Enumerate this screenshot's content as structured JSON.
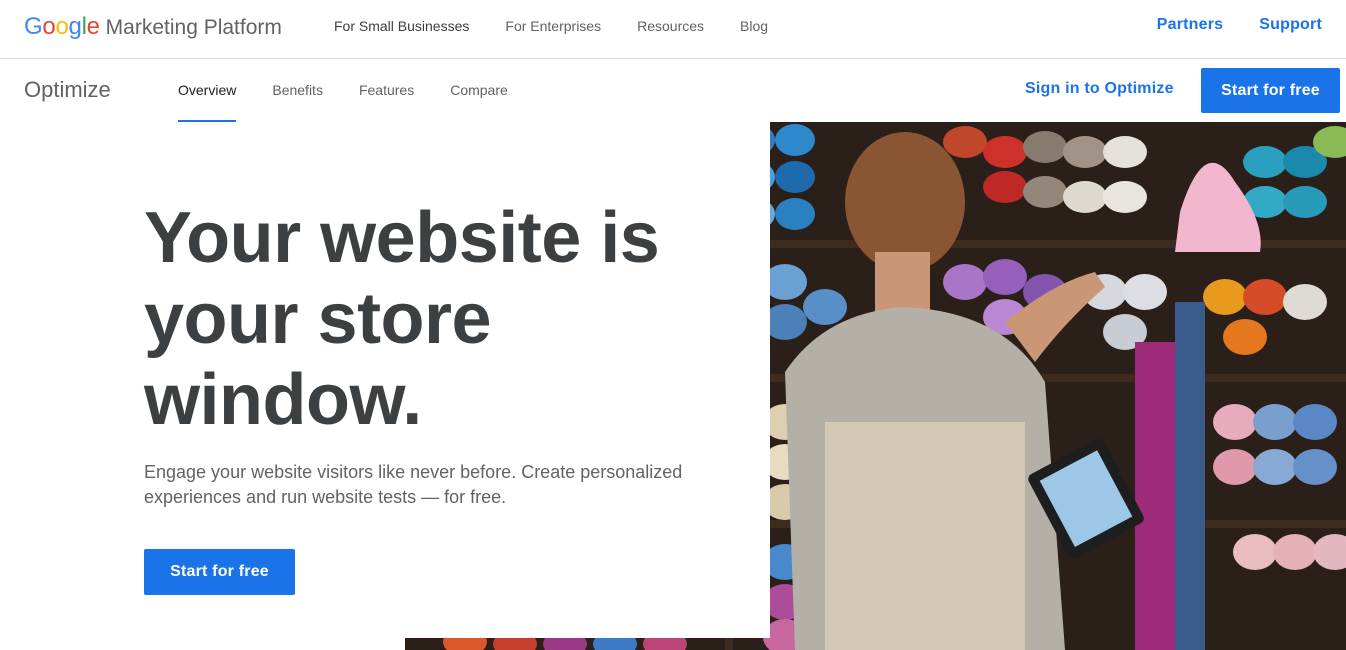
{
  "brand": {
    "google_letters": [
      "G",
      "o",
      "o",
      "g",
      "l",
      "e"
    ],
    "google_colors": [
      "#4285F4",
      "#EA4335",
      "#FBBC05",
      "#4285F4",
      "#34A853",
      "#EA4335"
    ],
    "product": "Marketing Platform"
  },
  "topnav": {
    "items": [
      "For Small Businesses",
      "For Enterprises",
      "Resources",
      "Blog"
    ],
    "right": [
      "Partners",
      "Support"
    ]
  },
  "subnav": {
    "title": "Optimize",
    "items": [
      "Overview",
      "Benefits",
      "Features",
      "Compare"
    ],
    "active": "Overview",
    "signin": "Sign in to Optimize",
    "cta": "Start for free"
  },
  "hero": {
    "headline_lines": [
      "Your website is",
      "your store",
      "window."
    ],
    "subtext_lines": [
      "Engage your website visitors like never before. Create personalized",
      "experiences and run website tests — for free."
    ],
    "cta": "Start for free"
  },
  "colors": {
    "accent": "#1a73e8",
    "text": "#3c4043",
    "muted": "#5f6368"
  }
}
